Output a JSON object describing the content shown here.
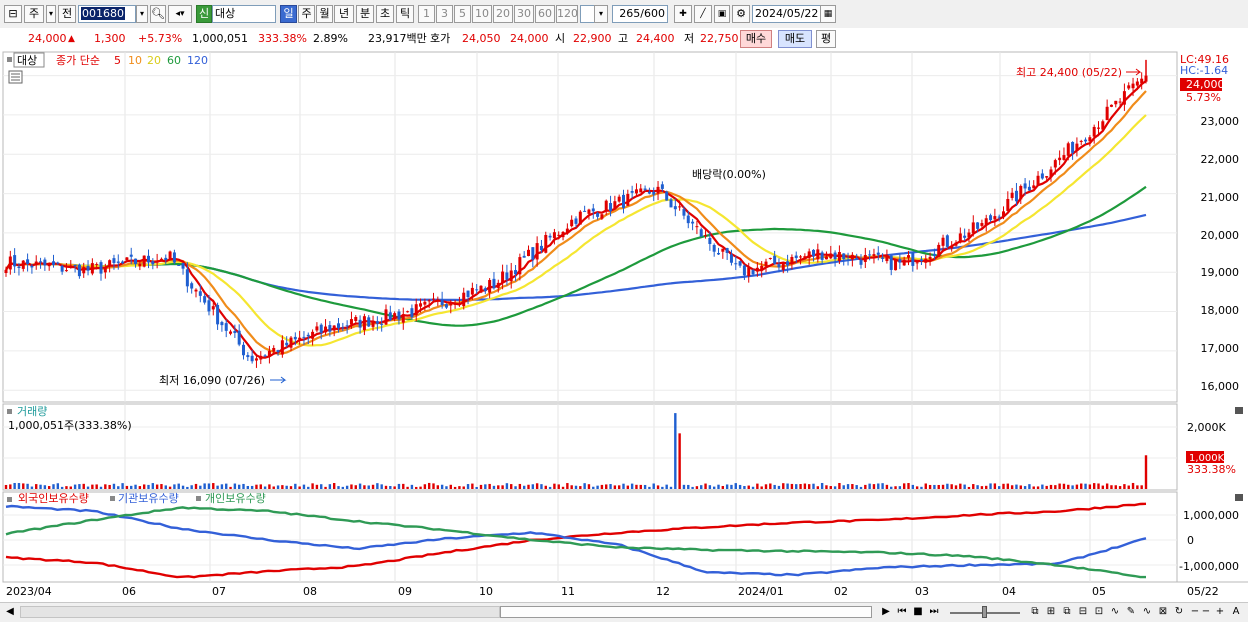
{
  "toolbar": {
    "market_type": "주",
    "prev_label": "전",
    "code": "001680",
    "mode_badge": "신",
    "stock_name": "대상",
    "periods": [
      "일",
      "주",
      "월",
      "년",
      "분",
      "초",
      "틱"
    ],
    "intervals": [
      "1",
      "3",
      "5",
      "10",
      "20",
      "30",
      "60",
      "120"
    ],
    "count_current": "265",
    "count_max": "/600",
    "date": "2024/05/22"
  },
  "quote": {
    "price": "24,000",
    "change": "1,300",
    "change_pct": "+5.73%",
    "volume": "1,000,051",
    "volume_ratio": "333.38%",
    "turnover": "2.89%",
    "amount": "23,917백만",
    "bid_label": "호가",
    "bid": "24,050",
    "ask": "24,000",
    "open_label": "시",
    "open": "22,900",
    "high_label": "고",
    "high": "24,400",
    "low_label": "저",
    "low": "22,750",
    "buy_button": "매수",
    "sell_button": "매도",
    "eval_button": "평"
  },
  "price_panel": {
    "stock_tag": "대상",
    "ma_label": "종가 단순",
    "ma_periods": [
      "5",
      "10",
      "20",
      "60",
      "120"
    ],
    "lc_label": "LC:49.16",
    "hc_label": "HC:-1.64",
    "current_price_tag": "24,000",
    "current_pct_tag": "5.73%",
    "high_annotation": "최고 24,400 (05/22)",
    "low_annotation": "최저 16,090 (07/26)",
    "dividend_annotation": "배당락(0.00%)",
    "y_ticks": [
      "23,000",
      "22,000",
      "21,000",
      "20,000",
      "19,000",
      "18,000",
      "17,000",
      "16,000"
    ]
  },
  "volume_panel": {
    "title": "거래량",
    "readout": "1,000,051주(333.38%)",
    "y_tick": "2,000K",
    "current_tag": "1,000K",
    "current_pct": "333.38%"
  },
  "holding_panel": {
    "legend": [
      "외국인보유수량",
      "기관보유수량",
      "개인보유수량"
    ],
    "y_ticks": [
      "1,000,000",
      "0",
      "-1,000,000"
    ]
  },
  "x_axis": {
    "labels": [
      "2023/04",
      "06",
      "07",
      "08",
      "09",
      "10",
      "11",
      "12",
      "2024/01",
      "02",
      "03",
      "04",
      "05",
      "05/22"
    ]
  },
  "colors": {
    "up": "#e00000",
    "down": "#1f5fd0",
    "ma5": "#e00000",
    "ma10": "#f08c1a",
    "ma20": "#f5e631",
    "ma60": "#1e9a3c",
    "ma120": "#3360d8",
    "foreign": "#e00000",
    "institution": "#3360d8",
    "individual": "#2f9a55"
  },
  "chart_data": {
    "type": "candlestick",
    "unit": "KRW",
    "annotations": {
      "high": {
        "value": 24400,
        "date": "05/22"
      },
      "low": {
        "value": 16090,
        "date": "07/26"
      }
    },
    "ylim": [
      15700,
      24600
    ],
    "anchors_close": [
      {
        "month": "2023/04",
        "close": 19250
      },
      {
        "month": "05",
        "close": 19050
      },
      {
        "month": "06",
        "close": 19400
      },
      {
        "month": "07",
        "close": 16800
      },
      {
        "month": "08",
        "close": 17600
      },
      {
        "month": "09",
        "close": 18000
      },
      {
        "month": "10",
        "close": 18700
      },
      {
        "month": "11",
        "close": 20400
      },
      {
        "month": "12",
        "close": 21100
      },
      {
        "month": "2024/01",
        "close": 19000
      },
      {
        "month": "02",
        "close": 19500
      },
      {
        "month": "03",
        "close": 19200
      },
      {
        "month": "04",
        "close": 20200
      },
      {
        "month": "05",
        "close": 22000
      },
      {
        "month": "05/22",
        "close": 24000
      }
    ],
    "volume_peak_k": 2250,
    "volume_last_k": 1000,
    "holdings_end": {
      "foreign": 1450000,
      "institution": 50000,
      "individual": -1500000
    }
  }
}
